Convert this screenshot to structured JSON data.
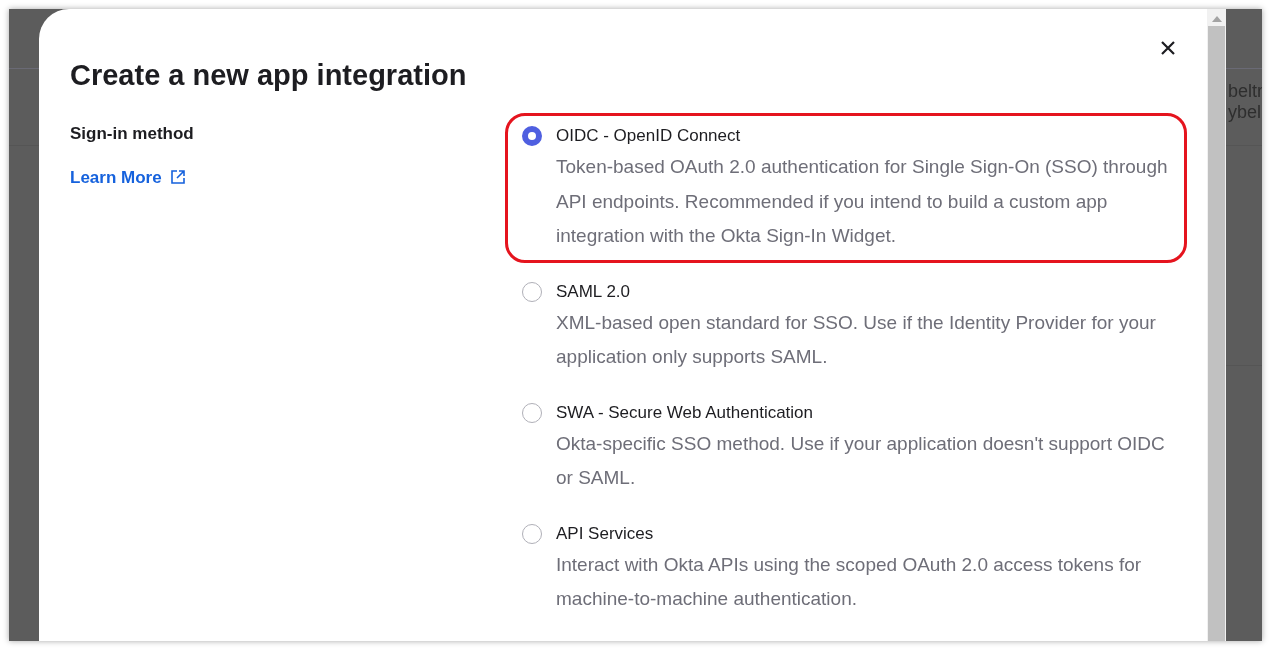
{
  "background": {
    "texts": [
      "beltr",
      "ybel"
    ]
  },
  "dialog": {
    "title": "Create a new app integration",
    "field_label": "Sign-in method",
    "learn_more_link": "Learn More",
    "options": [
      {
        "label": "OIDC - OpenID Connect",
        "selected": true,
        "highlighted": true,
        "description": "Token-based OAuth 2.0 authentication for Single Sign-On (SSO) through API endpoints. Recommended if you intend to build a custom app integration with the Okta Sign-In Widget."
      },
      {
        "label": "SAML 2.0",
        "selected": false,
        "highlighted": false,
        "description": "XML-based open standard for SSO. Use if the Identity Provider for your application only supports SAML."
      },
      {
        "label": "SWA - Secure Web Authentication",
        "selected": false,
        "highlighted": false,
        "description": "Okta-specific SSO method. Use if your application doesn't support OIDC or SAML."
      },
      {
        "label": "API Services",
        "selected": false,
        "highlighted": false,
        "description": "Interact with Okta APIs using the scoped OAuth 2.0 access tokens for machine-to-machine authentication."
      }
    ]
  }
}
